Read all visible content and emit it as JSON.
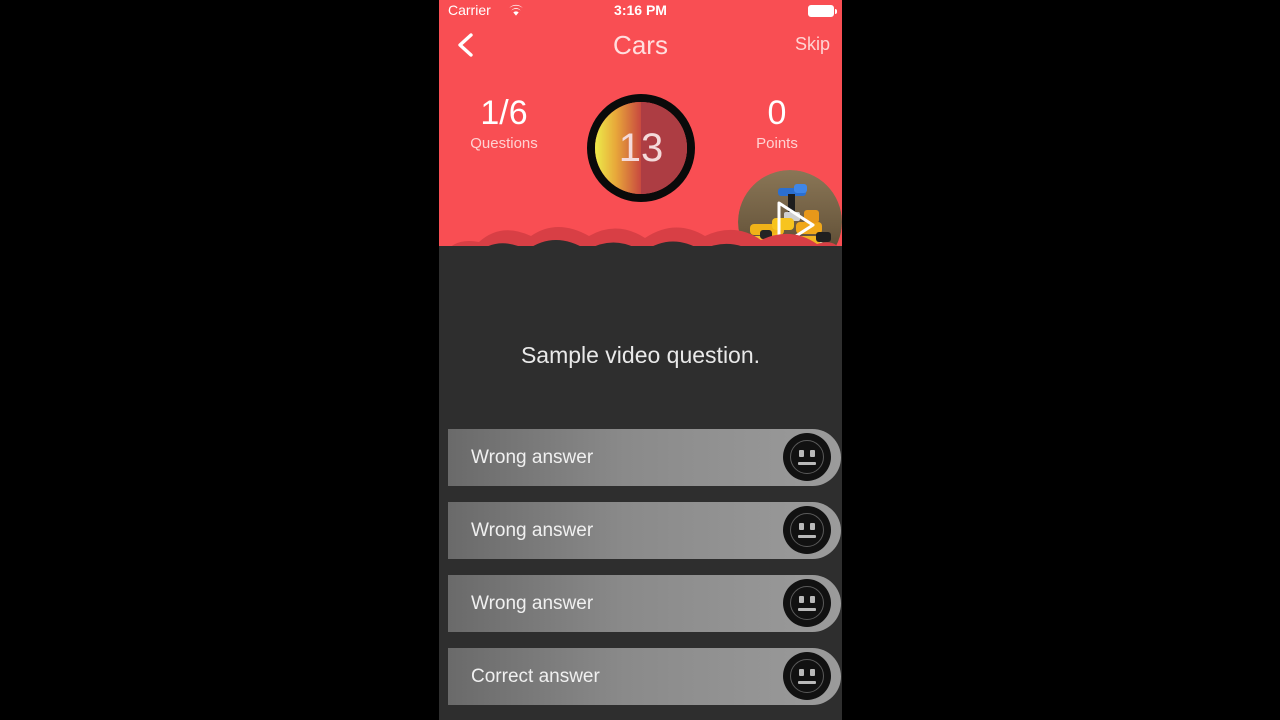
{
  "theme": {
    "accent_red": "#F94E53",
    "body_dark": "#2E2E2E",
    "answer_gray": "#8A8A8A",
    "timer_ring": "#000000",
    "timer_arc_start": "#E8E84A",
    "timer_arc_end": "#E86A2A"
  },
  "status_bar": {
    "carrier": "Carrier",
    "wifi_icon": "wifi-icon",
    "time": "3:16 PM",
    "battery_icon": "battery-full-icon"
  },
  "nav": {
    "back_icon": "chevron-left-icon",
    "title": "Cars",
    "skip_label": "Skip"
  },
  "stats": {
    "questions": {
      "value": "1/6",
      "label": "Questions"
    },
    "points": {
      "value": "0",
      "label": "Points"
    },
    "timer": {
      "seconds": "13",
      "total_seconds": 20,
      "remaining_fraction": 0.5
    }
  },
  "media": {
    "thumbnail_name": "video-thumbnail",
    "play_icon": "play-triangle-icon"
  },
  "question": {
    "text": "Sample video question."
  },
  "answers": [
    {
      "label": "Wrong answer",
      "face_icon": "neutral-face-icon"
    },
    {
      "label": "Wrong answer",
      "face_icon": "neutral-face-icon"
    },
    {
      "label": "Wrong answer",
      "face_icon": "neutral-face-icon"
    },
    {
      "label": "Correct answer",
      "face_icon": "neutral-face-icon"
    }
  ]
}
